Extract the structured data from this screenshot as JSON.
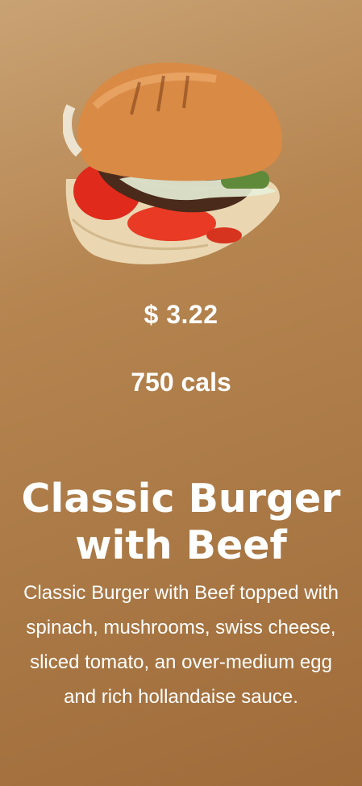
{
  "product": {
    "image_alt": "burger-image",
    "price": "$ 3.22",
    "calories": "750 cals",
    "name": "Classic Burger with Beef",
    "description": "Classic Burger with Beef topped with spinach, mushrooms, swiss cheese, sliced tomato, an over-medium egg and rich hollandaise sauce."
  },
  "colors": {
    "background_top": "#c9a274",
    "background_bottom": "#a06b3a",
    "text": "#ffffff"
  }
}
